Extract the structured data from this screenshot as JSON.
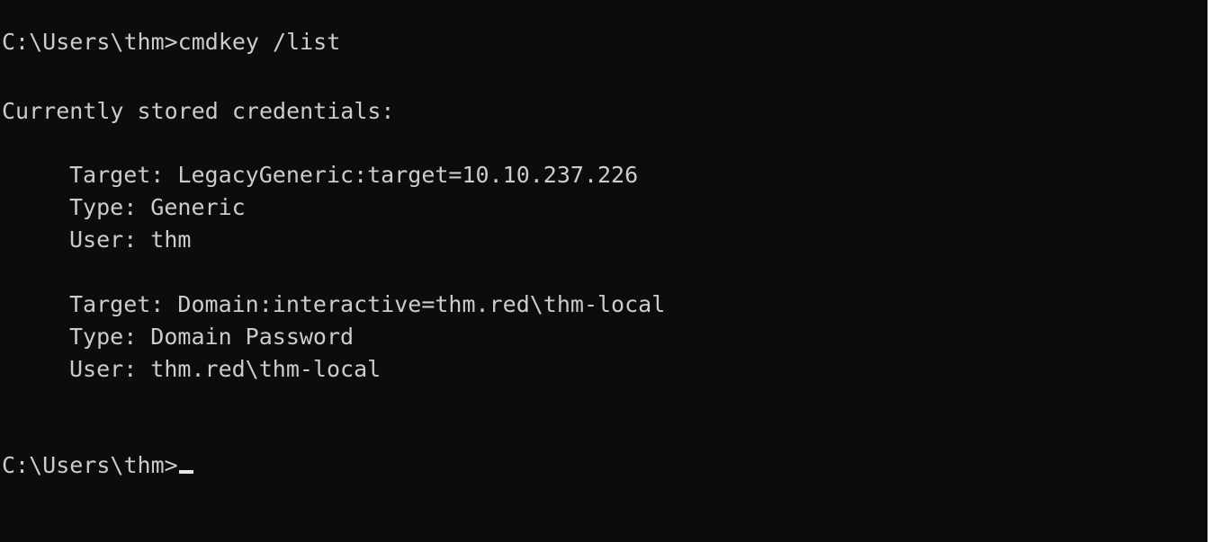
{
  "console": {
    "command_line": {
      "prompt": "C:\\Users\\thm>",
      "command": "cmdkey /list"
    },
    "header": "Currently stored credentials:",
    "credentials": [
      {
        "target": "Target: LegacyGeneric:target=10.10.237.226",
        "type": "Type: Generic",
        "user": "User: thm"
      },
      {
        "target": "Target: Domain:interactive=thm.red\\thm-local",
        "type": "Type: Domain Password",
        "user": "User: thm.red\\thm-local"
      }
    ],
    "final_prompt": "C:\\Users\\thm>"
  }
}
